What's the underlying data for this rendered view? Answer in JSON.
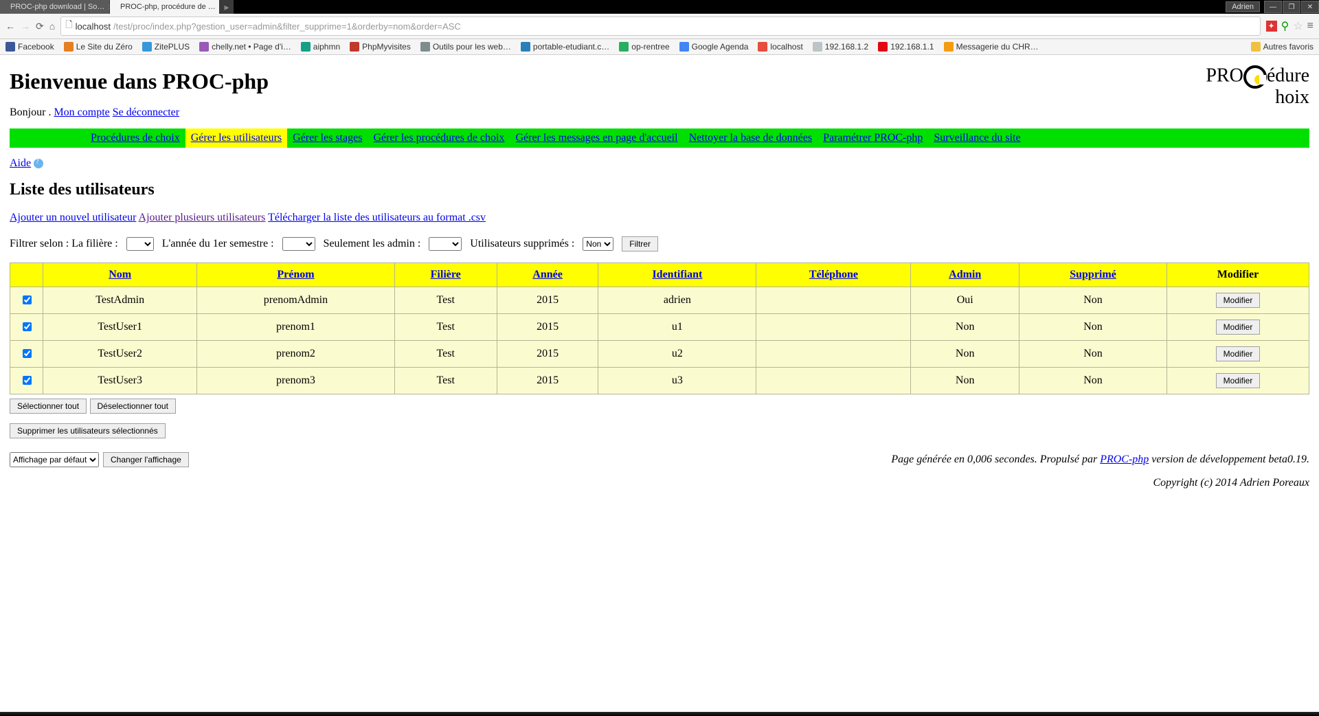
{
  "browser": {
    "tabs": [
      {
        "title": "PROC-php download | So…",
        "favicon_color": "#336699"
      },
      {
        "title": "PROC-php, procédure de …",
        "favicon_color": "#00aa00",
        "active": true
      }
    ],
    "user": "Adrien",
    "url_host": "localhost",
    "url_path": "/test/proc/index.php?gestion_user=admin&filter_supprime=1&orderby=nom&order=ASC"
  },
  "bookmarks": [
    {
      "label": "Facebook",
      "color": "#3b5998"
    },
    {
      "label": "Le Site du Zéro",
      "color": "#e67e22"
    },
    {
      "label": "ZitePLUS",
      "color": "#3498db"
    },
    {
      "label": "chelly.net • Page d'i…",
      "color": "#9b59b6"
    },
    {
      "label": "aiphmn",
      "color": "#16a085"
    },
    {
      "label": "PhpMyvisites",
      "color": "#c0392b"
    },
    {
      "label": "Outils pour les web…",
      "color": "#7f8c8d"
    },
    {
      "label": "portable-etudiant.c…",
      "color": "#2980b9"
    },
    {
      "label": "op-rentree",
      "color": "#27ae60"
    },
    {
      "label": "Google Agenda",
      "color": "#4285F4"
    },
    {
      "label": "localhost",
      "color": "#e74c3c"
    },
    {
      "label": "192.168.1.2",
      "color": "#bdc3c7"
    },
    {
      "label": "192.168.1.1",
      "color": "#e30613"
    },
    {
      "label": "Messagerie du CHR…",
      "color": "#f39c12"
    }
  ],
  "bookmarks_more": "Autres favoris",
  "page": {
    "title": "Bienvenue dans PROC-php",
    "greeting_prefix": "Bonjour . ",
    "my_account": "Mon compte",
    "logout": "Se déconnecter",
    "logo_top": "PRO",
    "logo_right_top": "édure",
    "logo_right_bottom": "hoix"
  },
  "menu": [
    {
      "label": "Procédures de choix"
    },
    {
      "label": "Gérer les utilisateurs",
      "active": true
    },
    {
      "label": "Gérer les stages"
    },
    {
      "label": "Gérer les procédures de choix"
    },
    {
      "label": "Gérer les messages en page d'accueil"
    },
    {
      "label": "Nettoyer la base de données"
    },
    {
      "label": "Paramétrer PROC-php"
    },
    {
      "label": "Surveillance du site"
    }
  ],
  "aide_label": "Aide",
  "list_title": "Liste des utilisateurs",
  "actions": {
    "add_one": "Ajouter un nouvel utilisateur",
    "add_many": "Ajouter plusieurs utilisateurs",
    "download_csv": "Télécharger la liste des utilisateurs au format .csv"
  },
  "filters": {
    "filiere_label": "Filtrer selon : La filière : ",
    "annee_label": "L'année du 1er semestre : ",
    "admin_label": "Seulement les admin : ",
    "supprime_label": "Utilisateurs supprimés : ",
    "supprime_value": "Non",
    "submit": "Filtrer"
  },
  "table": {
    "headers": {
      "nom": "Nom",
      "prenom": "Prénom",
      "filiere": "Filière",
      "annee": "Année",
      "identifiant": "Identifiant",
      "telephone": "Téléphone",
      "admin": "Admin",
      "supprime": "Supprimé",
      "modifier": "Modifier"
    },
    "modify_btn": "Modifier",
    "rows": [
      {
        "nom": "TestAdmin",
        "prenom": "prenomAdmin",
        "filiere": "Test",
        "annee": "2015",
        "identifiant": "adrien",
        "telephone": "",
        "admin": "Oui",
        "supprime": "Non"
      },
      {
        "nom": "TestUser1",
        "prenom": "prenom1",
        "filiere": "Test",
        "annee": "2015",
        "identifiant": "u1",
        "telephone": "",
        "admin": "Non",
        "supprime": "Non"
      },
      {
        "nom": "TestUser2",
        "prenom": "prenom2",
        "filiere": "Test",
        "annee": "2015",
        "identifiant": "u2",
        "telephone": "",
        "admin": "Non",
        "supprime": "Non"
      },
      {
        "nom": "TestUser3",
        "prenom": "prenom3",
        "filiere": "Test",
        "annee": "2015",
        "identifiant": "u3",
        "telephone": "",
        "admin": "Non",
        "supprime": "Non"
      }
    ]
  },
  "select_all": "Sélectionner tout",
  "deselect_all": "Déselectionner tout",
  "delete_selected": "Supprimer les utilisateurs sélectionnés",
  "display_select": "Affichage par défaut",
  "change_display": "Changer l'affichage",
  "footer": {
    "gen_prefix": "Page générée en 0,006 secondes. Propulsé par ",
    "link": "PROC-php",
    "gen_suffix": " version de développement beta0.19.",
    "copyright": "Copyright (c) 2014 Adrien Poreaux"
  }
}
